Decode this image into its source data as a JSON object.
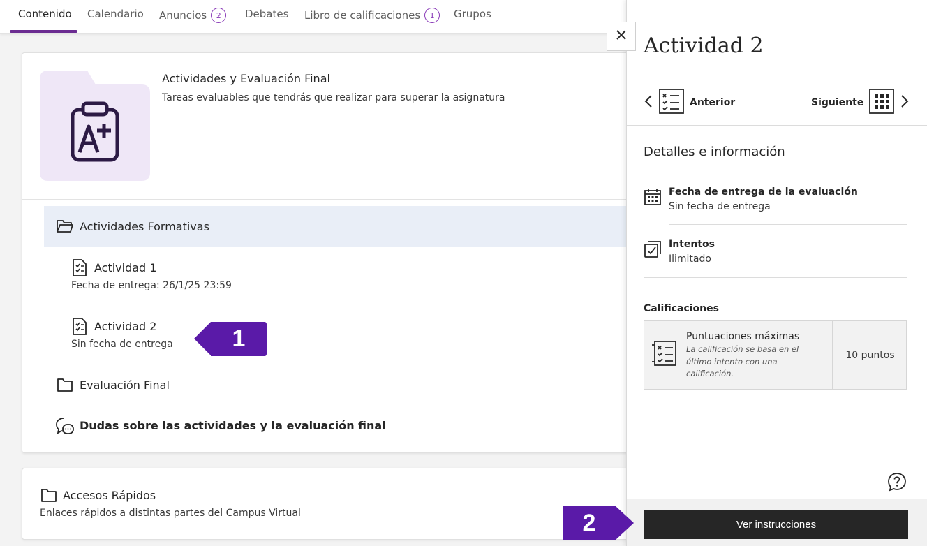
{
  "tabs": [
    {
      "label": "Contenido",
      "badge": null
    },
    {
      "label": "Calendario",
      "badge": null
    },
    {
      "label": "Anuncios",
      "badge": "2"
    },
    {
      "label": "Debates",
      "badge": null
    },
    {
      "label": "Libro de calificaciones",
      "badge": "1"
    },
    {
      "label": "Grupos",
      "badge": null
    }
  ],
  "module": {
    "title": "Actividades y Evaluación Final",
    "description": "Tareas evaluables que tendrás que realizar para superar la asignatura",
    "thumbnail_icon": "clipboard-grade-icon"
  },
  "items": {
    "formativas": {
      "label": "Actividades Formativas",
      "icon": "folder-open-icon"
    },
    "actividad1": {
      "label": "Actividad 1",
      "sub": "Fecha de entrega: 26/1/25 23:59",
      "icon": "assignment-icon"
    },
    "actividad2": {
      "label": "Actividad 2",
      "sub": "Sin fecha de entrega",
      "icon": "assignment-icon"
    },
    "evaluacion": {
      "label": "Evaluación Final",
      "icon": "folder-icon"
    },
    "dudas": {
      "label": "Dudas sobre las actividades y la evaluación final",
      "icon": "discussion-icon"
    }
  },
  "quick_access": {
    "title": "Accesos Rápidos",
    "description": "Enlaces rápidos a distintas partes del Campus Virtual"
  },
  "callouts": {
    "one": "1",
    "two": "2"
  },
  "panel": {
    "title": "Actividad 2",
    "prev_label": "Anterior",
    "next_label": "Siguiente",
    "section_title": "Detalles e información",
    "due": {
      "title": "Fecha de entrega de la evaluación",
      "value": "Sin fecha de entrega"
    },
    "attempts": {
      "title": "Intentos",
      "value": "Ilimitado"
    },
    "grades_heading": "Calificaciones",
    "grades": {
      "name": "Puntuaciones máximas",
      "note": "La calificación se basa en el último intento con una calificación.",
      "value": "10 puntos"
    },
    "primary_button": "Ver instrucciones"
  },
  "colors": {
    "accent": "#6b2c91",
    "callout": "#5a1aa8",
    "folder_bg": "#efe7f7",
    "selected_row": "#e9eef7",
    "primary_button": "#262626"
  }
}
